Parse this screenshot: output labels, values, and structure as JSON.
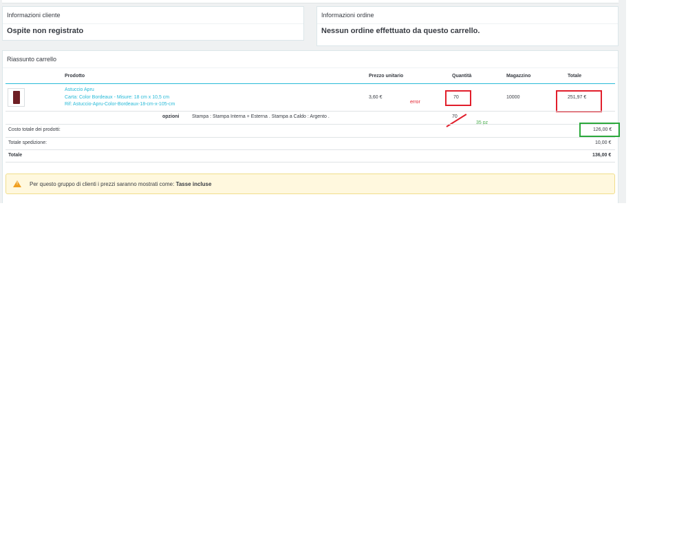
{
  "client_panel": {
    "title": "Informazioni cliente",
    "value": "Ospite non registrato"
  },
  "order_panel": {
    "title": "Informazioni ordine",
    "value": "Nessun ordine effettuato da questo carrello."
  },
  "cart": {
    "title": "Riassunto carrello",
    "columns": {
      "product": "Prodotto",
      "unit_price": "Prezzo unitario",
      "quantity": "Quantità",
      "stock": "Magazzino",
      "total": "Totale"
    },
    "item": {
      "name": "Astuccio Apru",
      "attributes": "Carta: Color Bordeaux - Misure: 18 cm x 10,5 cm",
      "reference": "Rif: Astuccio-Apru-Color-Bordeaux-18-cm-x-105-cm",
      "unit_price": "3,60 €",
      "quantity": "70",
      "stock": "10000",
      "total": "251,97 €"
    },
    "options": {
      "label": "opzioni",
      "value": "Stampa : Stampa Interna + Esterna . Stampa a Caldo : Argento .",
      "quantity": "70"
    },
    "summary": [
      {
        "label": "Costo totale dei prodotti:",
        "value": "126,00 €"
      },
      {
        "label": "Totale spedizione:",
        "value": "10,00 €"
      },
      {
        "label": "Totale",
        "value": "136,00 €"
      }
    ],
    "alert": {
      "text": "Per questo gruppo di clienti i prezzi saranno mostrati come:",
      "bold": "Tasse incluse",
      "icon": "warning-icon"
    }
  },
  "annotations": {
    "error_label": "error",
    "correct_qty": "35 pz"
  },
  "colors": {
    "accent": "#25b9d7",
    "error": "#e11d2a",
    "ok": "#2aa83a",
    "warning": "#f0a020"
  }
}
